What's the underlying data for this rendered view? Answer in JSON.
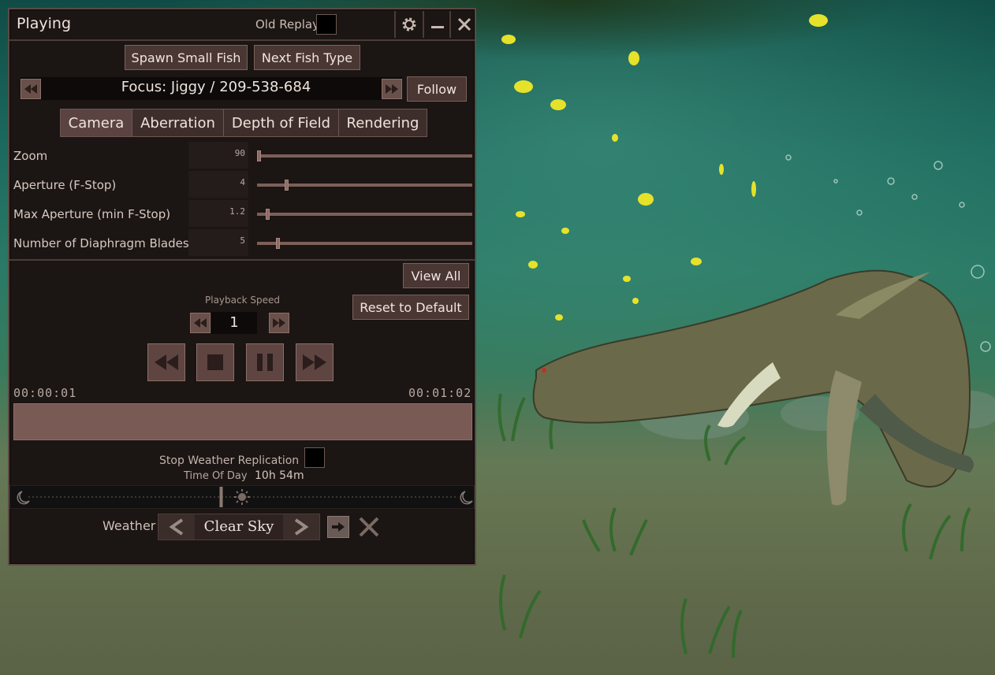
{
  "panel": {
    "title": "Playing",
    "old_replay_label": "Old Replay",
    "icons": {
      "settings": "gear-icon",
      "minimize": "minimize-icon",
      "close": "close-icon"
    }
  },
  "actions": {
    "spawn_small_fish": "Spawn Small Fish",
    "next_fish_type": "Next Fish Type"
  },
  "focus": {
    "text": "Focus: Jiggy / 209-538-684",
    "follow_label": "Follow"
  },
  "tabs": [
    "Camera",
    "Aberration",
    "Depth of Field",
    "Rendering"
  ],
  "sliders": [
    {
      "label": "Zoom",
      "value": "90",
      "fraction": 0.0
    },
    {
      "label": "Aperture (F-Stop)",
      "value": "4",
      "fraction": 0.13
    },
    {
      "label": "Max Aperture (min F-Stop)",
      "value": "1.2",
      "fraction": 0.04
    },
    {
      "label": "Number of Diaphragm Blades",
      "value": "5",
      "fraction": 0.09
    }
  ],
  "playback": {
    "view_all_label": "View All",
    "reset_label": "Reset to Default",
    "speed_label": "Playback Speed",
    "speed_value": "1",
    "time_start": "00:00:01",
    "time_end": "00:01:02",
    "transport_icons": [
      "rewind-icon",
      "stop-icon",
      "pause-icon",
      "fast-forward-icon"
    ]
  },
  "weather": {
    "stop_replication_label": "Stop Weather Replication",
    "time_of_day_label": "Time Of Day",
    "time_of_day_value": "10h 54m",
    "time_of_day_fraction": 0.45,
    "weather_label": "Weather",
    "weather_value": "Clear Sky"
  },
  "colors": {
    "panel_bg": "#1b1513",
    "button_bg": "#4a3633",
    "accent": "#7a5a55",
    "water": "#2a7a66"
  }
}
